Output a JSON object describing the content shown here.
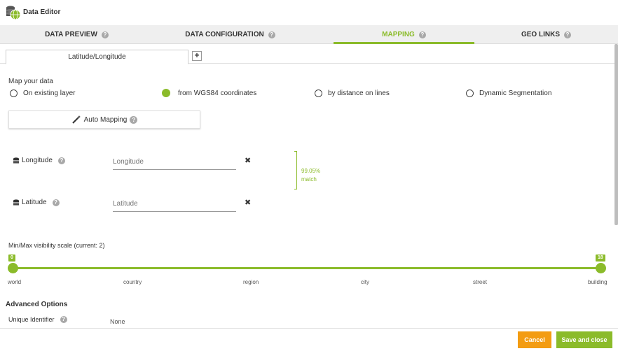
{
  "app": {
    "title": "Data Editor",
    "icon": "database-globe-icon"
  },
  "main_tabs": [
    {
      "label": "DATA PREVIEW",
      "active": false
    },
    {
      "label": "DATA CONFIGURATION",
      "active": false
    },
    {
      "label": "MAPPING",
      "active": true
    },
    {
      "label": "GEO LINKS",
      "active": false
    }
  ],
  "help_glyph": "?",
  "sub_tabs": {
    "active_label": "Latitude/Longitude",
    "add_glyph": "+"
  },
  "mapping": {
    "section_label": "Map your data",
    "options": [
      {
        "label": "On existing layer",
        "selected": false
      },
      {
        "label": "from WGS84 coordinates",
        "selected": true
      },
      {
        "label": "by distance on lines",
        "selected": false
      },
      {
        "label": "Dynamic Segmentation",
        "selected": false
      }
    ],
    "auto_mapping_label": "Auto Mapping"
  },
  "fields": {
    "longitude": {
      "label": "Longitude",
      "placeholder": "Longitude"
    },
    "latitude": {
      "label": "Latitude",
      "placeholder": "Latitude"
    },
    "clear_glyph": "✖",
    "match_line1": "99.05%",
    "match_line2": "match"
  },
  "scale": {
    "label": "Min/Max visibility scale (current: 2)",
    "min_value": "0",
    "max_value": "18",
    "ticks": [
      "world",
      "country",
      "region",
      "city",
      "street",
      "building"
    ]
  },
  "advanced": {
    "title": "Advanced Options",
    "unique_identifier_label": "Unique Identifier",
    "unique_identifier_value": "None"
  },
  "footer": {
    "cancel_label": "Cancel",
    "save_label": "Save and close"
  },
  "colors": {
    "accent": "#8bbb2a",
    "cancel": "#f39c12"
  }
}
